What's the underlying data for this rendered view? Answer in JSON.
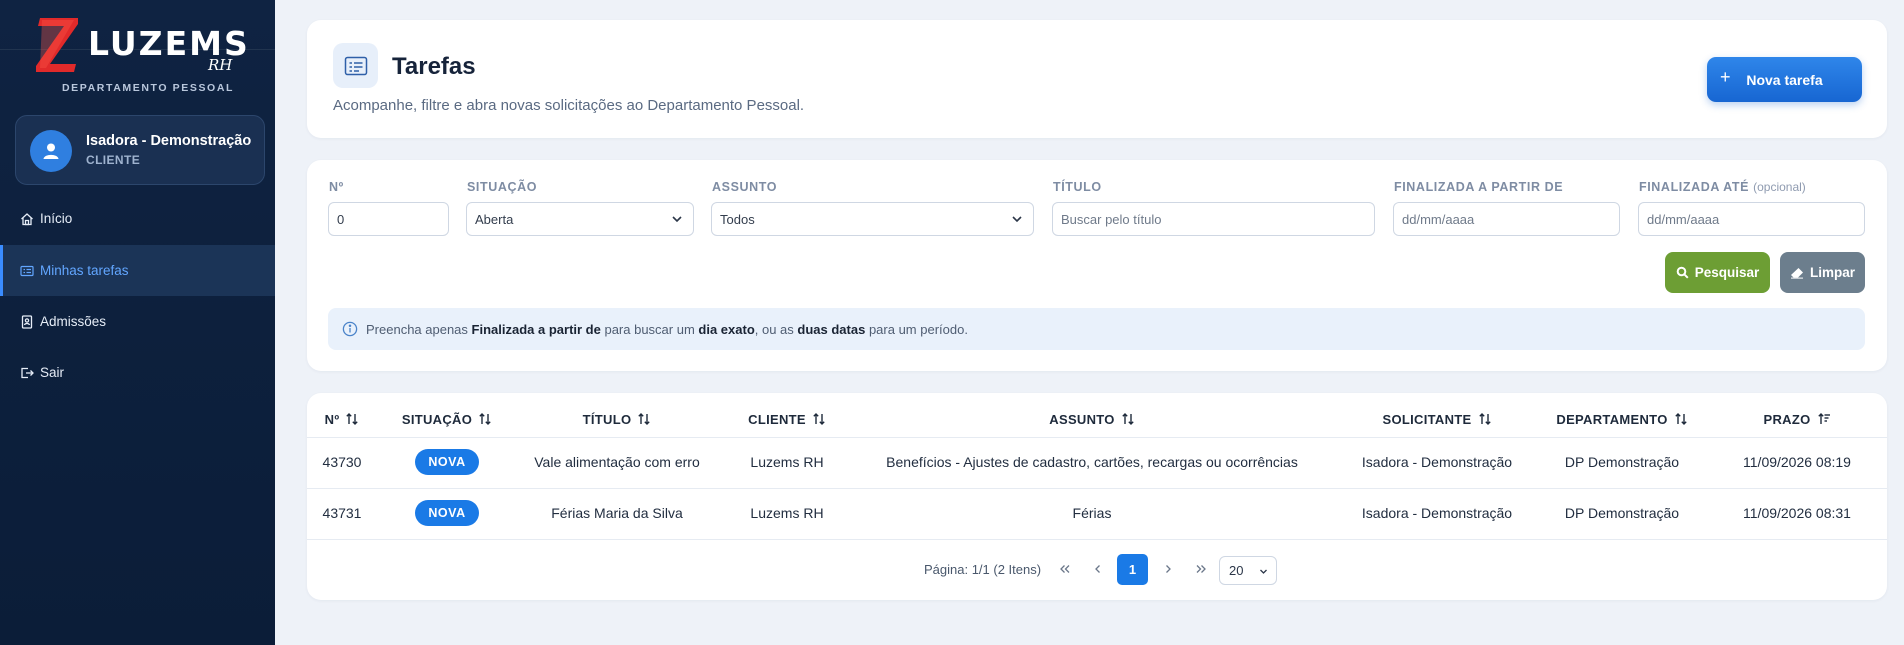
{
  "sidebar": {
    "logo_text": "LUZEMS",
    "logo_sub": "RH",
    "logo_tagline": "DEPARTAMENTO PESSOAL",
    "user": {
      "name": "Isadora - Demonstração",
      "role": "CLIENTE"
    },
    "items": [
      {
        "label": "Início",
        "icon": "home-icon",
        "active": false
      },
      {
        "label": "Minhas tarefas",
        "icon": "list-icon",
        "active": true
      },
      {
        "label": "Admissões",
        "icon": "id-card-icon",
        "active": false
      },
      {
        "label": "Sair",
        "icon": "logout-icon",
        "active": false
      }
    ]
  },
  "header": {
    "title": "Tarefas",
    "subtitle": "Acompanhe, filtre e abra novas solicitações ao Departamento Pessoal.",
    "new_button": "Nova tarefa"
  },
  "filters": {
    "number": {
      "label": "Nº",
      "value": "0"
    },
    "status": {
      "label": "SITUAÇÃO",
      "value": "Aberta"
    },
    "subject": {
      "label": "ASSUNTO",
      "value": "Todos"
    },
    "title": {
      "label": "TÍTULO",
      "placeholder": "Buscar pelo título"
    },
    "finished_from": {
      "label": "FINALIZADA A PARTIR DE",
      "placeholder": "dd/mm/aaaa"
    },
    "finished_to": {
      "label": "FINALIZADA ATÉ",
      "optional": "(opcional)",
      "placeholder": "dd/mm/aaaa"
    },
    "search_button": "Pesquisar",
    "clear_button": "Limpar",
    "info": {
      "t1": "Preencha apenas ",
      "b1": "Finalizada a partir de",
      "t2": " para buscar um ",
      "b2": "dia exato",
      "t3": ", ou as ",
      "b3": "duas datas",
      "t4": " para um período."
    }
  },
  "table": {
    "columns": [
      "Nº",
      "SITUAÇÃO",
      "TÍTULO",
      "CLIENTE",
      "ASSUNTO",
      "SOLICITANTE",
      "DEPARTAMENTO",
      "PRAZO"
    ],
    "rows": [
      {
        "number": "43730",
        "status": "NOVA",
        "title": "Vale alimentação com erro",
        "client": "Luzems RH",
        "subject": "Benefícios - Ajustes de cadastro, cartões, recargas ou ocorrências",
        "requester": "Isadora - Demonstração",
        "department": "DP Demonstração",
        "deadline": "11/09/2026 08:19"
      },
      {
        "number": "43731",
        "status": "NOVA",
        "title": "Férias Maria da Silva",
        "client": "Luzems RH",
        "subject": "Férias",
        "requester": "Isadora - Demonstração",
        "department": "DP Demonstração",
        "deadline": "11/09/2026 08:31"
      }
    ]
  },
  "pagination": {
    "summary": "Página: 1/1 (2 Itens)",
    "current_page": "1",
    "page_size": "20"
  },
  "colors": {
    "sidebar_bg": "#0f2342",
    "accent": "#1a7ae6",
    "search_green": "#6d9e34",
    "clear_gray": "#6c7e8d"
  }
}
